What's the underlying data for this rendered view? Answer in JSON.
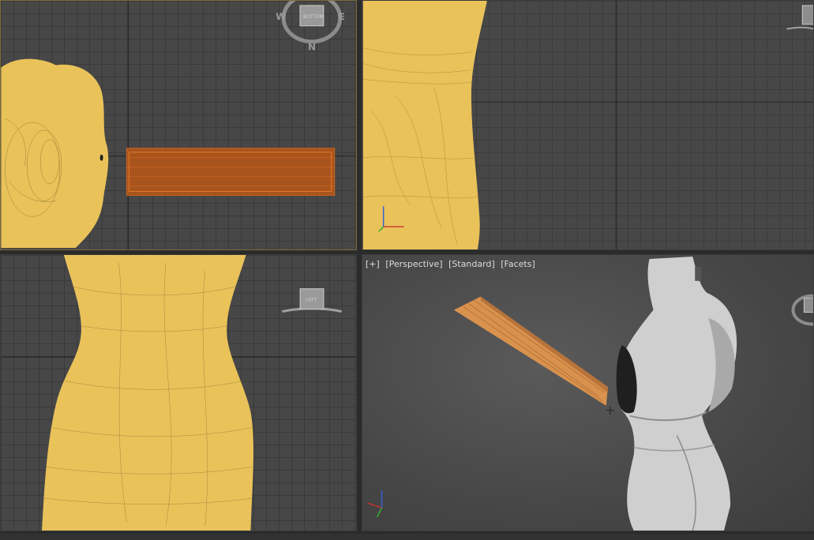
{
  "viewports": {
    "top": {
      "cube_label": "BOTTOM",
      "compass": {
        "west": "W",
        "east": "E",
        "north": "N"
      }
    },
    "front": {},
    "left": {
      "cube_label": "LEFT"
    },
    "perspective": {
      "label_plus": "[+]",
      "label_view": "[Perspective]",
      "label_shading": "[Standard]",
      "label_mode": "[Facets]"
    }
  },
  "colors": {
    "mannequin_wire": "#e9c25a",
    "selected_object": "#c8651f",
    "perspective_object": "#d9924e",
    "mannequin_shaded": "#cfcfcf",
    "viewport_bg": "#474747"
  },
  "icons": [
    "viewcube-icon",
    "compass-icon",
    "axis-tripod-icon",
    "pivot-cross-icon"
  ]
}
